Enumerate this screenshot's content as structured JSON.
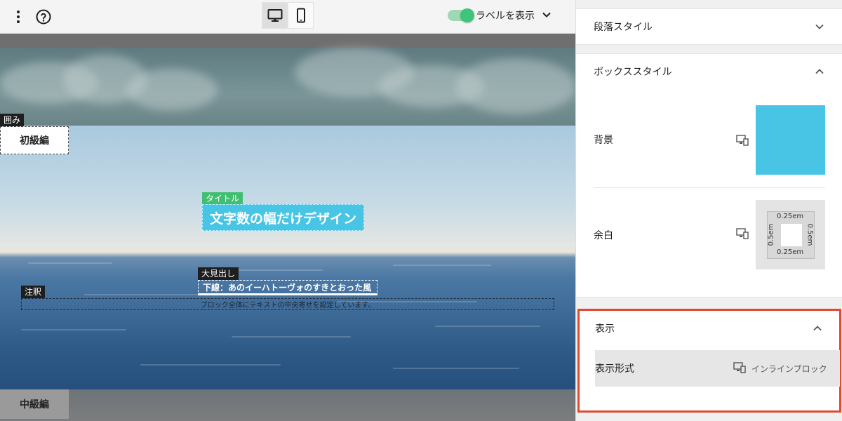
{
  "toolbar": {
    "menu_icon": "more-vertical-icon",
    "help_icon": "help-circle-icon",
    "devices": [
      "desktop",
      "mobile"
    ],
    "active_device": "desktop",
    "show_labels_text": "ラベルを表示",
    "show_labels_on": true
  },
  "canvas": {
    "tag_box": "囲み",
    "box_beginner": "初級編",
    "tag_title": "タイトル",
    "title_text": "文字数の幅だけデザイン",
    "tag_heading": "大見出し",
    "heading_text": "下線：あのイーハトーヴォのすきとおった風",
    "tag_note": "注釈",
    "note_text": "ブロック全体にテキストの中央寄せを設定しています。",
    "box_middle": "中級編"
  },
  "panel": {
    "paragraph_style": "段落スタイル",
    "box_style": "ボックススタイル",
    "background_label": "背景",
    "background_color": "#48c4e4",
    "spacing_label": "余白",
    "spacing": {
      "top": "0.25em",
      "bottom": "0.25em",
      "left": "0.5em",
      "right": "0.5em"
    },
    "display_section": "表示",
    "display_format_label": "表示形式",
    "display_format_value": "インラインブロック",
    "highlight_color": "#e04a2f"
  }
}
